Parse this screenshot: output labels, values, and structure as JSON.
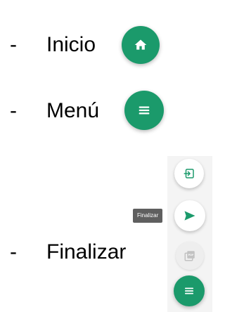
{
  "legend": {
    "items": [
      {
        "dash": "-",
        "label": "Inicio"
      },
      {
        "dash": "-",
        "label": "Menú"
      },
      {
        "dash": "-",
        "label": "Finalizar"
      }
    ]
  },
  "fab_menu": {
    "tooltip": "Finalizar",
    "buttons": [
      {
        "icon": "login-icon",
        "state": "enabled"
      },
      {
        "icon": "send-icon",
        "state": "enabled"
      },
      {
        "icon": "pdf-icon",
        "state": "disabled"
      },
      {
        "icon": "menu-icon",
        "state": "active"
      }
    ]
  },
  "icons": {
    "home": "home-icon",
    "menu": "menu-icon"
  },
  "colors": {
    "accent": "#1b9a6b",
    "tooltip_bg": "#5f5f5f",
    "disabled_bg": "#eeeeee",
    "panel_bg": "#f4f4f4"
  }
}
